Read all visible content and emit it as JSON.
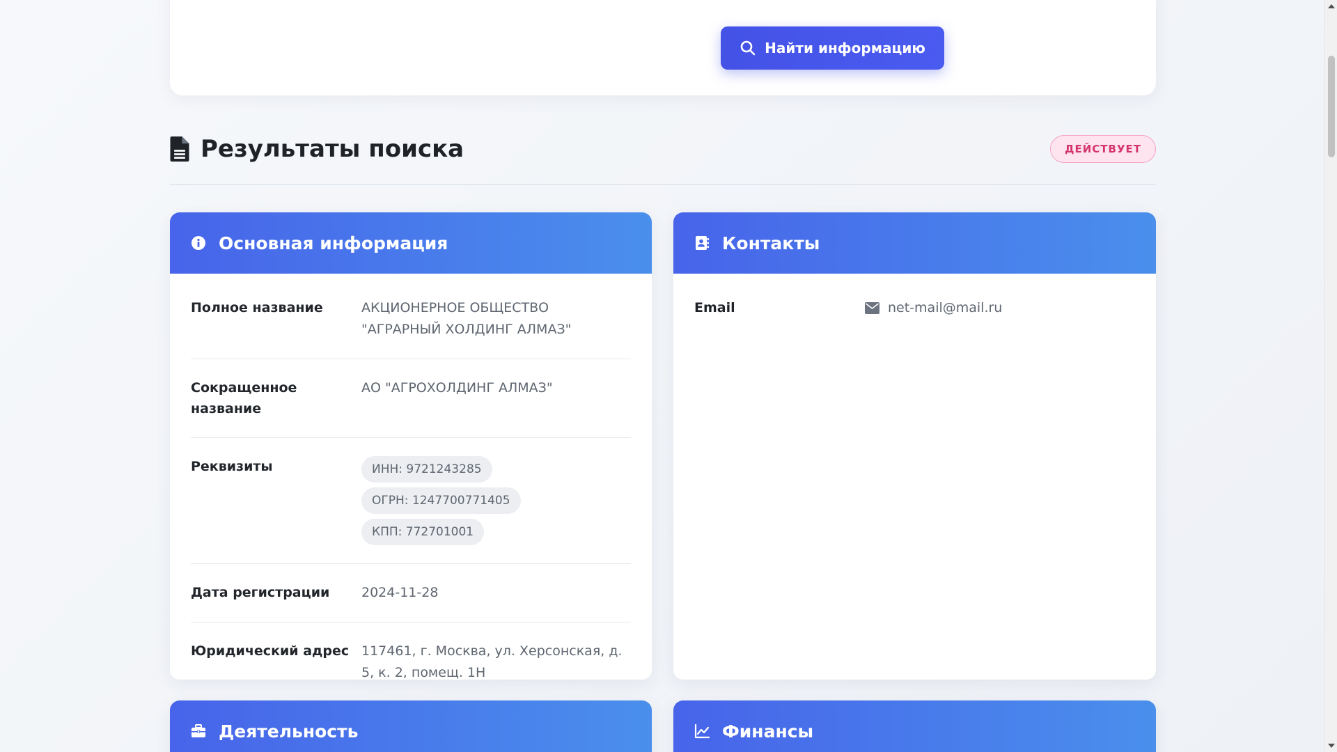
{
  "search": {
    "button_label": "Найти информацию",
    "button_icon": "search-icon"
  },
  "results": {
    "title": "Результаты поиска",
    "title_icon": "file-document-icon",
    "status_badge": "ДЕЙСТВУЕТ"
  },
  "basic_info": {
    "header": "Основная информация",
    "header_icon": "info-circle-icon",
    "full_name_label": "Полное название",
    "full_name_value": "АКЦИОНЕРНОЕ ОБЩЕСТВО \"АГРАРНЫЙ ХОЛДИНГ АЛМАЗ\"",
    "short_name_label": "Сокращенное название",
    "short_name_value": "АО \"АГРОХОЛДИНГ АЛМАЗ\"",
    "requisites_label": "Реквизиты",
    "requisites": {
      "inn": "ИНН: 9721243285",
      "ogrn": "ОГРН: 1247700771405",
      "kpp": "КПП: 772701001"
    },
    "reg_date_label": "Дата регистрации",
    "reg_date_value": "2024-11-28",
    "address_label": "Юридический адрес",
    "address_value": "117461, г. Москва, ул. Херсонская, д. 5, к. 2, помещ. 1Н"
  },
  "contacts": {
    "header": "Контакты",
    "header_icon": "address-book-icon",
    "email_label": "Email",
    "email_value": "net-mail@mail.ru",
    "email_icon": "envelope-icon"
  },
  "activity": {
    "header": "Деятельность",
    "header_icon": "briefcase-icon"
  },
  "finance": {
    "header": "Финансы",
    "header_icon": "chart-line-icon"
  },
  "colors": {
    "primary": "#4452e6",
    "header_gradient_start": "#4764ea",
    "header_gradient_end": "#4a8fec",
    "badge_text": "#d6336c",
    "badge_bg": "#fde4ef"
  }
}
